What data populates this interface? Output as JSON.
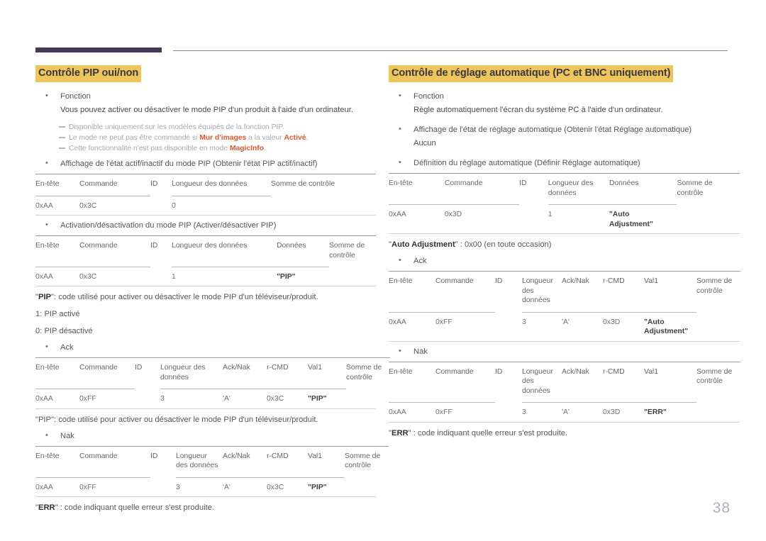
{
  "page": {
    "number": "38",
    "accent_bar_color": "#453b54",
    "highlight_color": "#ecc659",
    "term_color": "#e8552a"
  },
  "left": {
    "title": "Contrôle PIP oui/non",
    "fonction_label": "Fonction",
    "fonction_text": "Vous pouvez activer ou désactiver le mode PIP d'un produit à l'aide d'un ordinateur.",
    "notes": [
      {
        "pre": "Disponible uniquement sur les modèles équipés de la fonction PIP.",
        "b1": "",
        "mid": "",
        "b2": "",
        "post": ""
      },
      {
        "pre": "Le mode ne peut pas être commandé si ",
        "b1": "Mur d'images",
        "mid": " a la valeur ",
        "b2": "Activé",
        "post": "."
      },
      {
        "pre": "Cette fonctionnalité n'est pas disponible en mode ",
        "b1": "MagicInfo",
        "mid": "",
        "b2": "",
        "post": "."
      }
    ],
    "get_bullet": "Affichage de l'état actif/inactif du mode PIP (Obtenir l'état PIP actif/inactif)",
    "get_table": {
      "headers": [
        "En-tête",
        "Commande",
        "ID",
        "Longueur des données",
        "Somme de contrôle"
      ],
      "row": [
        "0xAA",
        "0x3C",
        "",
        "0",
        ""
      ]
    },
    "set_bullet": "Activation/désactivation du mode PIP (Activer/désactiver PIP)",
    "set_table": {
      "headers": [
        "En-tête",
        "Commande",
        "ID",
        "Longueur des données",
        "Données",
        "Somme de contrôle"
      ],
      "row": [
        "0xAA",
        "0x3C",
        "",
        "1",
        "\"PIP\"",
        ""
      ]
    },
    "pip_caption_pre": "\"",
    "pip_caption_bold": "PIP",
    "pip_caption_post": "\": code utilisé pour activer ou désactiver le mode PIP d'un téléviseur/produit.",
    "pip_on": "1: PIP activé",
    "pip_off": "0: PIP désactivé",
    "ack_bullet": "Ack",
    "ack_table": {
      "headers": [
        "En-tête",
        "Commande",
        "ID",
        "Longueur des données",
        "Ack/Nak",
        "r-CMD",
        "Val1",
        "Somme de contrôle"
      ],
      "row": [
        "0xAA",
        "0xFF",
        "",
        "3",
        "'A'",
        "0x3C",
        "\"PIP\"",
        ""
      ]
    },
    "ack_caption": "\"PIP\": code utilisé pour activer ou désactiver le mode PIP d'un téléviseur/produit.",
    "nak_bullet": "Nak",
    "nak_table": {
      "headers": [
        "En-tête",
        "Commande",
        "ID",
        "Longueur des données",
        "Ack/Nak",
        "r-CMD",
        "Val1",
        "Somme de contrôle"
      ],
      "row": [
        "0xAA",
        "0xFF",
        "",
        "3",
        "'A'",
        "0x3C",
        "\"PIP\"",
        ""
      ]
    },
    "err_caption_pre": "\"",
    "err_caption_bold": "ERR",
    "err_caption_post": "\" : code indiquant quelle erreur s'est produite."
  },
  "right": {
    "title": "Contrôle de réglage automatique (PC et BNC uniquement)",
    "fonction_label": "Fonction",
    "fonction_text": "Règle automatiquement l'écran du système PC à l'aide d'un ordinateur.",
    "get_bullet": "Affichage de l'état de réglage automatique (Obtenir l'état Réglage automatique)",
    "get_sub": "Aucun",
    "set_bullet": "Définition du réglage automatique (Définir Réglage automatique)",
    "set_table": {
      "headers": [
        "En-tête",
        "Commande",
        "ID",
        "Longueur des données",
        "Données",
        "Somme de contrôle"
      ],
      "row": [
        "0xAA",
        "0x3D",
        "",
        "1",
        "\"Auto Adjustment\"",
        ""
      ]
    },
    "auto_caption_pre": "\"",
    "auto_caption_bold": "Auto Adjustment",
    "auto_caption_post": "\" : 0x00 (en toute occasion)",
    "ack_bullet": "Ack",
    "ack_table": {
      "headers": [
        "En-tête",
        "Commande",
        "ID",
        "Longueur des données",
        "Ack/Nak",
        "r-CMD",
        "Val1",
        "Somme de contrôle"
      ],
      "row": [
        "0xAA",
        "0xFF",
        "",
        "3",
        "'A'",
        "0x3D",
        "\"Auto Adjustment\"",
        ""
      ]
    },
    "nak_bullet": "Nak",
    "nak_table": {
      "headers": [
        "En-tête",
        "Commande",
        "ID",
        "Longueur des données",
        "Ack/Nak",
        "r-CMD",
        "Val1",
        "Somme de contrôle"
      ],
      "row": [
        "0xAA",
        "0xFF",
        "",
        "3",
        "'A'",
        "0x3D",
        "\"ERR\"",
        ""
      ]
    },
    "err_caption_pre": "\"",
    "err_caption_bold": "ERR",
    "err_caption_post": "\" : code indiquant quelle erreur s'est produite."
  }
}
